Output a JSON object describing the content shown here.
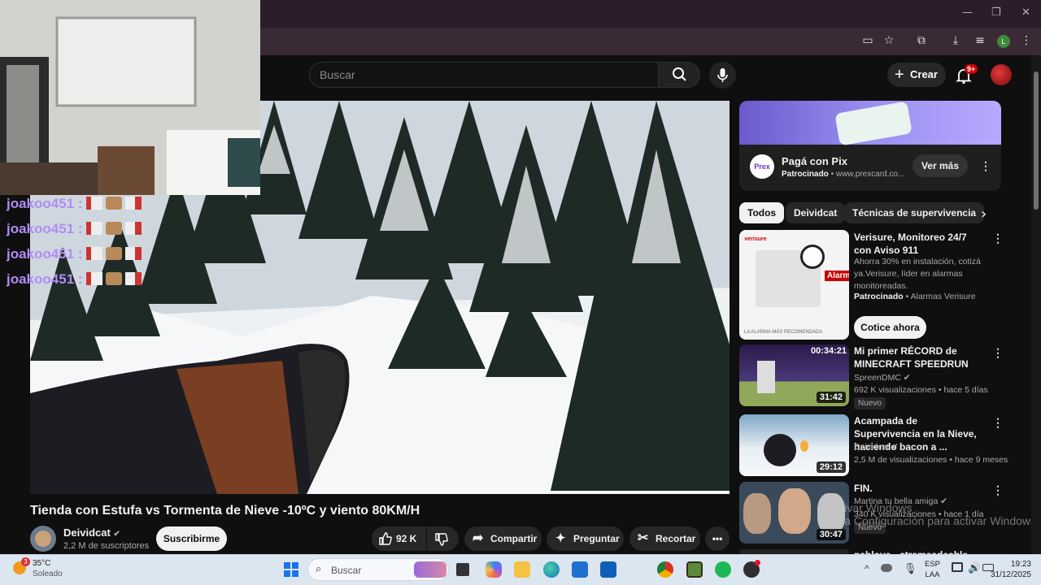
{
  "youtube": {
    "search_placeholder": "Buscar",
    "create_label": "Crear",
    "notif_count": "9+"
  },
  "chat": [
    {
      "user": "joakoo451",
      "sep": ":"
    },
    {
      "user": "joakoo451",
      "sep": ":"
    },
    {
      "user": "joakoo451",
      "sep": ":"
    },
    {
      "user": "joakoo451",
      "sep": ":"
    }
  ],
  "video": {
    "title": "Tienda con Estufa vs Tormenta de Nieve -10ºC y viento 80KM/H",
    "channel": "Deividcat",
    "subscribers": "2,2 M de suscriptores",
    "subscribe_label": "Suscribirme",
    "likes": "92 K",
    "share_label": "Compartir",
    "ask_label": "Preguntar",
    "clip_label": "Recortar"
  },
  "ad": {
    "logo": "Prex",
    "title": "Pagá con Pix",
    "sponsored": "Patrocinado",
    "url": "www.prexcard.co...",
    "cta": "Ver más"
  },
  "chips": [
    "Todos",
    "Deividcat",
    "Técnicas de supervivencia"
  ],
  "related": [
    {
      "title": "Verisure, Monitoreo 24/7 con Aviso 911",
      "desc": "Ahorra 30% en instalación, cotizá ya.Verisure, líder en alarmas monitoreadas.",
      "sponsor_label": "Patrocinado",
      "sponsor": "Alarmas Verisure",
      "cta": "Cotice ahora",
      "thumb_text": "LA ALARMA MÁS RECOMENDADA",
      "brand": "verisure",
      "alarm_text": "Alarma"
    },
    {
      "title": "Mi primer RÉCORD de MINECRAFT SPEEDRUN",
      "channel": "SpreenDMC",
      "meta": "692 K visualizaciones • hace 5 días",
      "badge": "Nuevo",
      "duration": "31:42",
      "thumb_time": "00:34:21"
    },
    {
      "title": "Acampada de Supervivencia en la Nieve, haciendo bacon a ...",
      "channel": "Deividcat",
      "meta": "2,5 M de visualizaciones • hace 9 meses",
      "duration": "29:12"
    },
    {
      "title": "FIN.",
      "channel": "Martina tu bella amiga",
      "meta": "340 K visualizaciones • hace 1 día",
      "badge": "Nuevo",
      "duration": "30:47"
    },
    {
      "title": "pablove - ctrameadeable (Full"
    }
  ],
  "watermark": {
    "line1": "Activar Windows",
    "line2": "Ve a Configuración para activar Windows."
  },
  "taskbar": {
    "weather_temp": "35°C",
    "weather_desc": "Soleado",
    "weather_badge": "3",
    "search_label": "Buscar",
    "lang1": "ESP",
    "lang2": "LAA",
    "time": "19:23",
    "date": "31/12/2025"
  },
  "colors": {
    "chat_user": "#b08cf6",
    "title_bar": "#2b1d29",
    "address_bar": "#3a2a36",
    "notif_badge": "#cc0000"
  },
  "icons": [
    "minimize-icon",
    "restore-icon",
    "close-icon",
    "cast-icon",
    "bookmark-star-icon",
    "extensions-icon",
    "download-icon",
    "media-icon",
    "profile-icon",
    "menu-icon",
    "search-icon",
    "mic-icon",
    "plus-icon",
    "bell-icon",
    "like-icon",
    "dislike-icon",
    "share-icon",
    "sparkle-icon",
    "scissors-icon",
    "more-icon",
    "chevron-right-icon",
    "verified-icon"
  ]
}
